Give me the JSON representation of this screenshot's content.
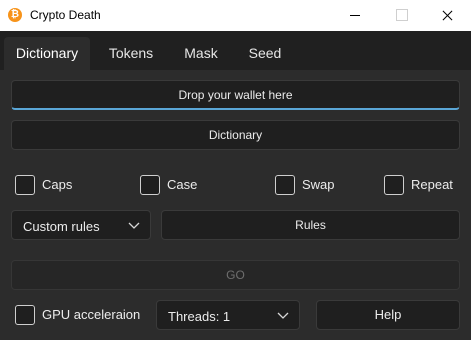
{
  "window": {
    "title": "Crypto Death",
    "icon": "bitcoin-icon",
    "accent": "#f7931a"
  },
  "tabs": [
    {
      "label": "Dictionary",
      "active": true
    },
    {
      "label": "Tokens",
      "active": false
    },
    {
      "label": "Mask",
      "active": false
    },
    {
      "label": "Seed",
      "active": false
    }
  ],
  "main": {
    "drop_label": "Drop your wallet here",
    "dictionary_label": "Dictionary",
    "checkboxes": [
      {
        "label": "Caps",
        "checked": false
      },
      {
        "label": "Case",
        "checked": false
      },
      {
        "label": "Swap",
        "checked": false
      },
      {
        "label": "Repeat",
        "checked": false
      }
    ],
    "rules_select": "Custom rules",
    "rules_button": "Rules",
    "go_label": "GO",
    "go_enabled": false,
    "gpu_label": "GPU acceleraion",
    "gpu_checked": false,
    "threads_select": "Threads: 1",
    "help_label": "Help"
  },
  "colors": {
    "drop_underline": "#5aa6d6"
  }
}
